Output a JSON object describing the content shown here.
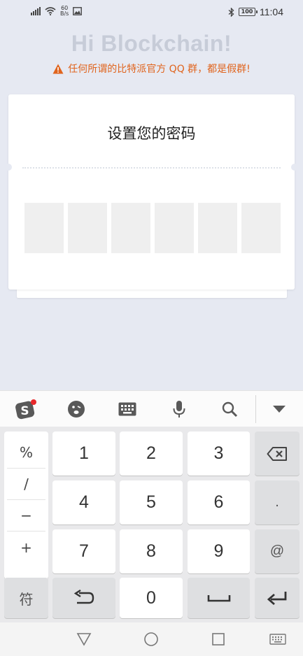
{
  "status_bar": {
    "net_speed_value": "60",
    "net_speed_unit": "B/s",
    "battery": "100",
    "time": "11:04"
  },
  "header": {
    "title": "Hi Blockchain!",
    "warning": "任何所谓的比特派官方 QQ 群，都是假群!"
  },
  "card": {
    "title": "设置您的密码",
    "pin_length": 6
  },
  "keyboard": {
    "toolbar_icons": [
      "sogou-logo-icon",
      "emoji-icon",
      "keyboard-icon",
      "microphone-icon",
      "search-icon",
      "collapse-icon"
    ],
    "symbols": [
      "%",
      "/",
      "−",
      "+"
    ],
    "digits": [
      "1",
      "2",
      "3",
      "4",
      "5",
      "6",
      "7",
      "8",
      "9",
      "0"
    ],
    "dot": ".",
    "at": "@",
    "symbols_key": "符",
    "accent_color": "#e0641d"
  },
  "nav_bar": {
    "icons": [
      "back-icon",
      "home-icon",
      "recents-icon",
      "keyboard-switch-icon"
    ]
  }
}
